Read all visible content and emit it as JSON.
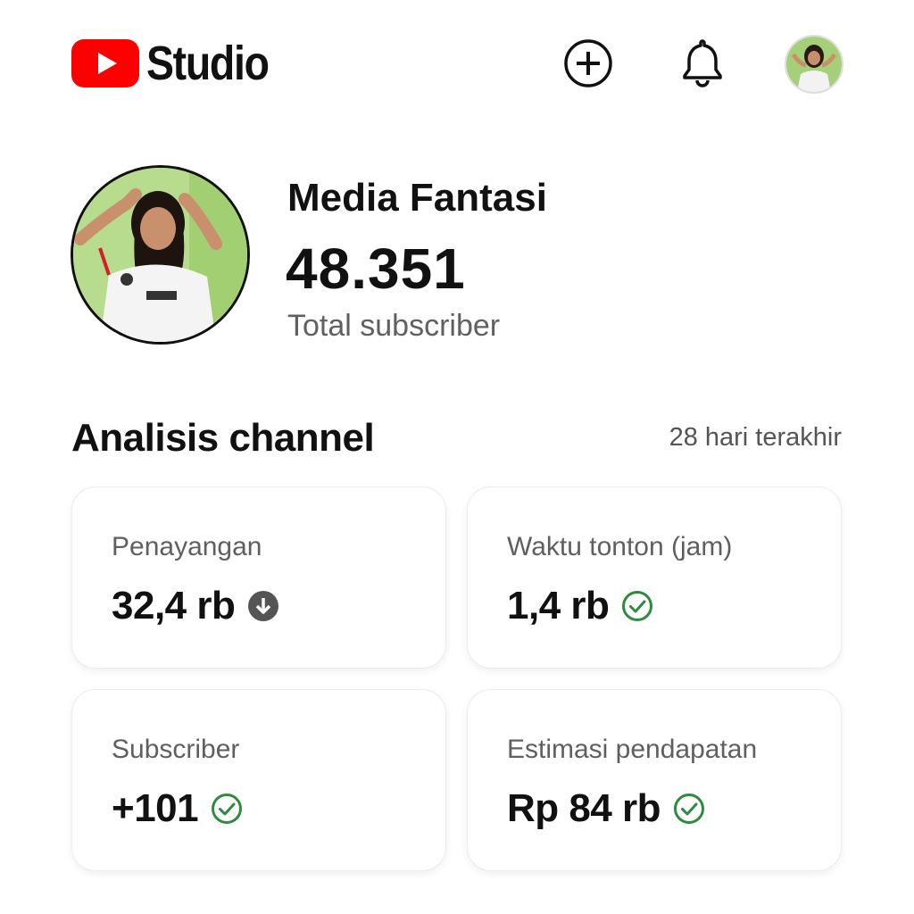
{
  "app": {
    "logo_text": "Studio",
    "brand_color": "#ff0000"
  },
  "header": {
    "create_icon": "add-circle-icon",
    "notifications_icon": "bell-icon"
  },
  "channel": {
    "name": "Media Fantasi",
    "subscribers": "48.351",
    "subscribers_label": "Total subscriber"
  },
  "analytics": {
    "title": "Analisis channel",
    "period": "28 hari terakhir",
    "cards": [
      {
        "label": "Penayangan",
        "value": "32,4 rb",
        "status_icon": "arrow-down-circle-icon",
        "status_color": "#555555"
      },
      {
        "label": "Waktu tonton (jam)",
        "value": "1,4 rb",
        "status_icon": "check-circle-icon",
        "status_color": "#2e8b3e"
      },
      {
        "label": "Subscriber",
        "value": "+101",
        "status_icon": "check-circle-icon",
        "status_color": "#2e8b3e"
      },
      {
        "label": "Estimasi pendapatan",
        "value": "Rp 84 rb",
        "status_icon": "check-circle-icon",
        "status_color": "#2e8b3e"
      }
    ]
  }
}
